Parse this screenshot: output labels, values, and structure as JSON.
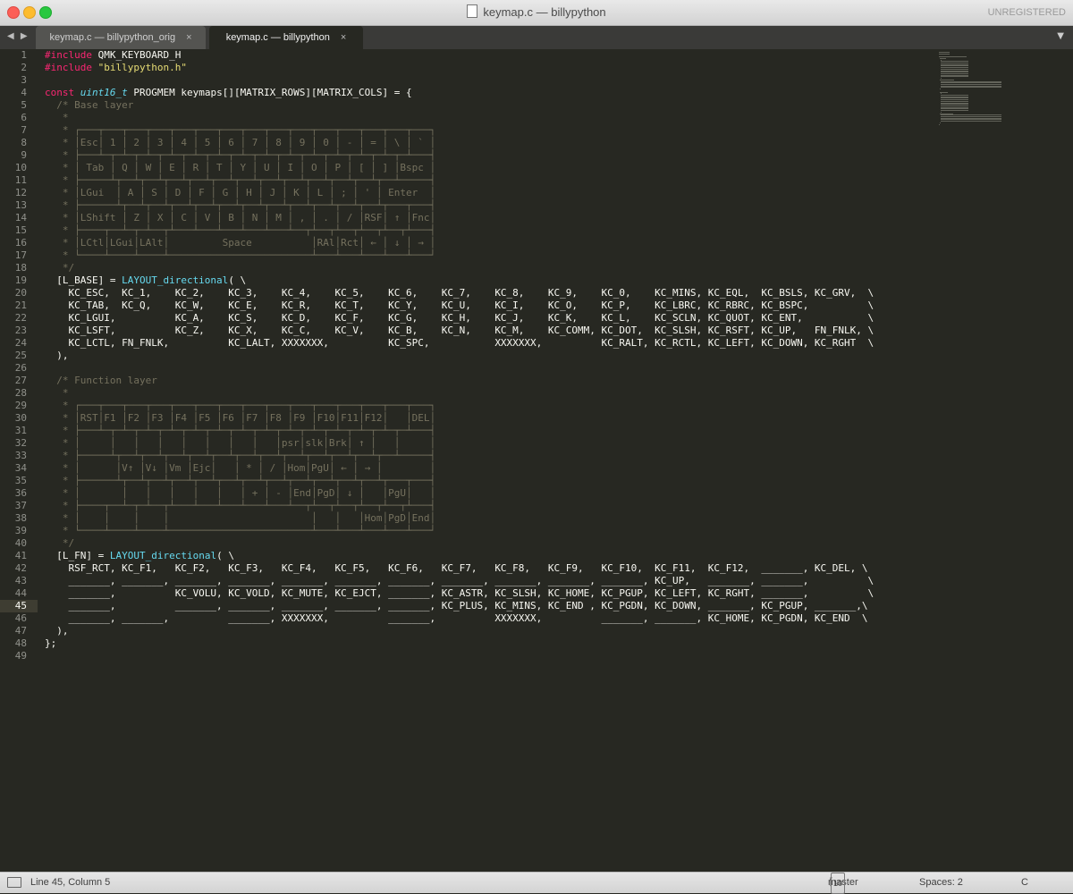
{
  "window": {
    "title": "keymap.c — billypython",
    "unregistered": "UNREGISTERED"
  },
  "tabs": [
    {
      "label": "keymap.c — billypython_orig",
      "close": "×"
    },
    {
      "label": "keymap.c — billypython",
      "close": "×"
    }
  ],
  "nav_arrows": "◀ ▶",
  "tab_menu": "▼",
  "editor": {
    "current_line": 45,
    "lines": [
      "#include QMK_KEYBOARD_H",
      "#include \"billypython.h\"",
      "",
      "const uint16_t PROGMEM keymaps[][MATRIX_ROWS][MATRIX_COLS] = {",
      "  /* Base layer",
      "   *",
      "   * ┌───┬───┬───┬───┬───┬───┬───┬───┬───┬───┬───┬───┬───┬───┬───┐",
      "   * │Esc│ 1 │ 2 │ 3 │ 4 │ 5 │ 6 │ 7 │ 8 │ 9 │ 0 │ - │ = │ \\ │ ` │",
      "   * ├───┴─┬─┴─┬─┴─┬─┴─┬─┴─┬─┴─┬─┴─┬─┴─┬─┴─┬─┴─┬─┴─┬─┴─┬─┴─┬─┴───┤",
      "   * │ Tab │ Q │ W │ E │ R │ T │ Y │ U │ I │ O │ P │ [ │ ] │Bspc │",
      "   * ├─────┴┬──┴┬──┴┬──┴┬──┴┬──┴┬──┴┬──┴┬──┴┬──┴┬──┴┬──┴┬──┴─────┤",
      "   * │LGui  │ A │ S │ D │ F │ G │ H │ J │ K │ L │ ; │ ' │ Enter  │",
      "   * ├──────┴┬──┴┬──┴┬──┴┬──┴┬──┴┬──┴┬──┴┬──┴┬──┴┬──┴┬──┴┬───┬───┤",
      "   * │LShift │ Z │ X │ C │ V │ B │ N │ M │ , │ . │ / │RSF│ ↑ │Fnc│",
      "   * ├────┬──┴─┬─┴──┬┴───┴───┴───┴───┴───┴──┬┴──┬┴──┬┴──┬┴──┬┴───┤",
      "   * │LCtl│LGui│LAlt│         Space          │RAl│Rct│ ← │ ↓ │ → │",
      "   * └────┴────┴────┴────────────────────────┴───┴───┴───┴───┴───┘",
      "   */",
      "  [L_BASE] = LAYOUT_directional( \\",
      "    KC_ESC,  KC_1,    KC_2,    KC_3,    KC_4,    KC_5,    KC_6,    KC_7,    KC_8,    KC_9,    KC_0,    KC_MINS, KC_EQL,  KC_BSLS, KC_GRV,  \\",
      "    KC_TAB,  KC_Q,    KC_W,    KC_E,    KC_R,    KC_T,    KC_Y,    KC_U,    KC_I,    KC_O,    KC_P,    KC_LBRC, KC_RBRC, KC_BSPC,          \\",
      "    KC_LGUI,          KC_A,    KC_S,    KC_D,    KC_F,    KC_G,    KC_H,    KC_J,    KC_K,    KC_L,    KC_SCLN, KC_QUOT, KC_ENT,           \\",
      "    KC_LSFT,          KC_Z,    KC_X,    KC_C,    KC_V,    KC_B,    KC_N,    KC_M,    KC_COMM, KC_DOT,  KC_SLSH, KC_RSFT, KC_UP,   FN_FNLK, \\",
      "    KC_LCTL, FN_FNLK,          KC_LALT, XXXXXXX,          KC_SPC,           XXXXXXX,          KC_RALT, KC_RCTL, KC_LEFT, KC_DOWN, KC_RGHT  \\",
      "  ),",
      "",
      "  /* Function layer",
      "   *",
      "   * ┌───┬───┬───┬───┬───┬───┬───┬───┬───┬───┬───┬───┬───┬───┬───┐",
      "   * │RST│F1 │F2 │F3 │F4 │F5 │F6 │F7 │F8 │F9 │F10│F11│F12│   │DEL│",
      "   * ├───┴─┬─┴─┬─┴─┬─┴─┬─┴─┬─┴─┬─┴─┬─┴─┬─┴─┬─┴─┬─┴─┬─┴─┬─┴─┬─┴───┤",
      "   * │     │   │   │   │   │   │   │   │psr│slk│Brk│ ↑ │   │     │",
      "   * ├─────┴┬──┴┬──┴┬──┴┬──┴┬──┴┬──┴┬──┴┬──┴┬──┴┬──┴┬──┴┬──┴─────┤",
      "   * │      │V↑ │V↓ │Vm │Ejc│   │ * │ / │Hom│PgU│ ← │ → │        │",
      "   * ├──────┴┬──┴┬──┴┬──┴┬──┴┬──┴┬──┴┬──┴┬──┴┬──┴┬──┴┬──┴┬───┬───┤",
      "   * │       │   │   │   │   │   │ + │ - │End│PgD│ ↓ │   │PgU│   │",
      "   * ├────┬──┴─┬─┴──┬┴───┴───┴───┴───┴───┴──┬┴──┬┴──┬┴──┬┴──┬┴───┤",
      "   * │    │    │    │                        │   │   │Hom│PgD│End│",
      "   * └────┴────┴────┴────────────────────────┴───┴───┴───┴───┴───┘",
      "   */",
      "  [L_FN] = LAYOUT_directional( \\",
      "    RSF_RCT, KC_F1,   KC_F2,   KC_F3,   KC_F4,   KC_F5,   KC_F6,   KC_F7,   KC_F8,   KC_F9,   KC_F10,  KC_F11,  KC_F12,  _______, KC_DEL, \\",
      "    _______, _______, _______, _______, _______, _______, _______, _______, _______, _______, _______, KC_UP,   _______, _______,          \\",
      "    _______,          KC_VOLU, KC_VOLD, KC_MUTE, KC_EJCT, _______, KC_ASTR, KC_SLSH, KC_HOME, KC_PGUP, KC_LEFT, KC_RGHT, _______,          \\",
      "    _______,          _______, _______, _______, _______, _______, KC_PLUS, KC_MINS, KC_END , KC_PGDN, KC_DOWN, _______, KC_PGUP, _______,\\",
      "    _______, _______,          _______, XXXXXXX,          _______,          XXXXXXX,          _______, _______, KC_HOME, KC_PGDN, KC_END  \\",
      "  ),",
      "};",
      ""
    ]
  },
  "status": {
    "position": "Line 45, Column 5",
    "branch": "master",
    "branch_badge": "10",
    "indent": "Spaces: 2",
    "syntax": "C"
  },
  "colors": {
    "background": "#272822",
    "keyword": "#f92672",
    "string": "#e6db74",
    "type": "#66d9ef",
    "comment": "#75715e"
  }
}
